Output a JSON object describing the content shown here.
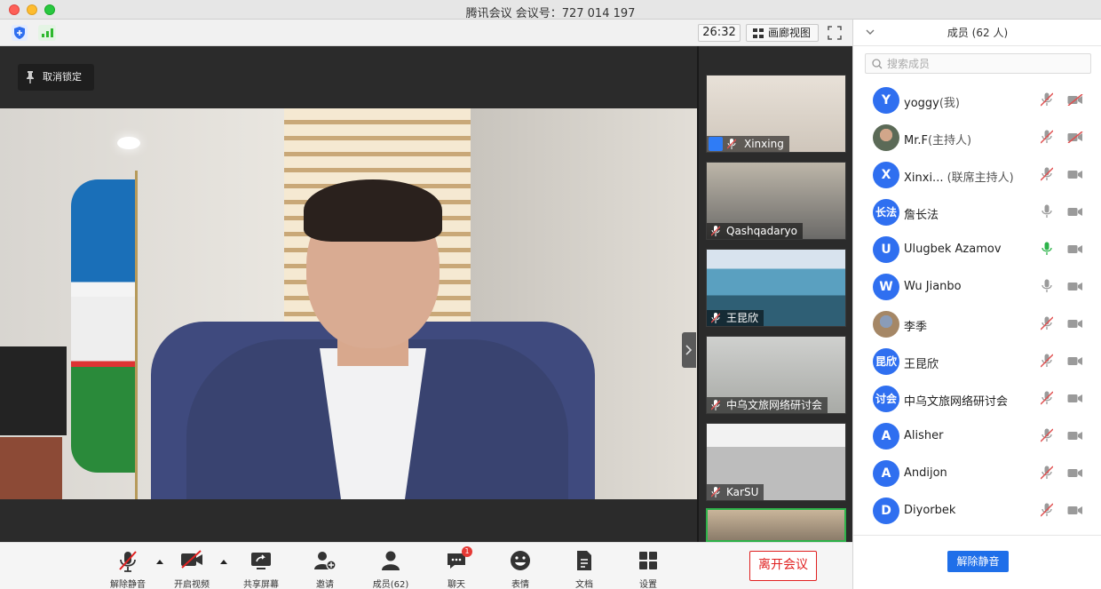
{
  "window": {
    "title": "腾讯会议 会议号：727 014 197"
  },
  "toolbar": {
    "timer": "26:32",
    "gallery_label": "画廊视图"
  },
  "stage": {
    "unlock_label": "取消锁定"
  },
  "thumbnails": [
    {
      "label": "Xinxing"
    },
    {
      "label": "Qashqadaryo"
    },
    {
      "label": "王昆欣"
    },
    {
      "label": "中乌文旅网络研讨会"
    },
    {
      "label": "KarSU"
    }
  ],
  "panel": {
    "title": "成员 (62 人)",
    "search_placeholder": "搜索成员",
    "unmute_all": "解除静音",
    "members": [
      {
        "avatar": "Y",
        "name": "yoggy",
        "role": "(我)"
      },
      {
        "avatar": "",
        "name": "Mr.F",
        "role": "(主持人)"
      },
      {
        "avatar": "X",
        "name": "Xinxi...",
        "role": " (联席主持人)"
      },
      {
        "avatar": "长法",
        "name": "詹长法",
        "role": ""
      },
      {
        "avatar": "U",
        "name": "Ulugbek Azamov",
        "role": ""
      },
      {
        "avatar": "W",
        "name": "Wu Jianbo",
        "role": ""
      },
      {
        "avatar": "",
        "name": "李季",
        "role": ""
      },
      {
        "avatar": "昆欣",
        "name": "王昆欣",
        "role": ""
      },
      {
        "avatar": "讨会",
        "name": "中乌文旅网络研讨会",
        "role": ""
      },
      {
        "avatar": "A",
        "name": "Alisher",
        "role": ""
      },
      {
        "avatar": "A",
        "name": "Andijon",
        "role": ""
      },
      {
        "avatar": "D",
        "name": "Diyorbek",
        "role": ""
      }
    ]
  },
  "controls": {
    "unmute": "解除静音",
    "start_video": "开启视频",
    "share_screen": "共享屏幕",
    "invite": "邀请",
    "members": "成员(62)",
    "chat": "聊天",
    "chat_badge": "1",
    "emoji": "表情",
    "docs": "文档",
    "settings": "设置",
    "leave": "离开会议"
  },
  "colors": {
    "accent": "#1f6fe9",
    "leave": "#e02020",
    "active_mic": "#2db34a",
    "muted": "#e05050"
  }
}
